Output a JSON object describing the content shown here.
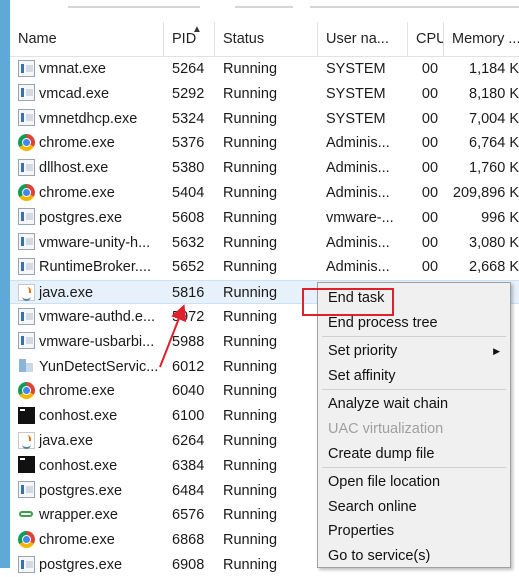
{
  "columns": {
    "name": "Name",
    "pid": "PID",
    "status": "Status",
    "user": "User na...",
    "cpu": "CPU",
    "memory": "Memory ..."
  },
  "processes": [
    {
      "name": "vmnat.exe",
      "icon": "exe",
      "pid": "5264",
      "status": "Running",
      "user": "SYSTEM",
      "cpu": "00",
      "memory": "1,184 K"
    },
    {
      "name": "vmcad.exe",
      "icon": "exe",
      "pid": "5292",
      "status": "Running",
      "user": "SYSTEM",
      "cpu": "00",
      "memory": "8,180 K"
    },
    {
      "name": "vmnetdhcp.exe",
      "icon": "exe",
      "pid": "5324",
      "status": "Running",
      "user": "SYSTEM",
      "cpu": "00",
      "memory": "7,004 K"
    },
    {
      "name": "chrome.exe",
      "icon": "chrome",
      "pid": "5376",
      "status": "Running",
      "user": "Adminis...",
      "cpu": "00",
      "memory": "6,764 K"
    },
    {
      "name": "dllhost.exe",
      "icon": "exe",
      "pid": "5380",
      "status": "Running",
      "user": "Adminis...",
      "cpu": "00",
      "memory": "1,760 K"
    },
    {
      "name": "chrome.exe",
      "icon": "chrome",
      "pid": "5404",
      "status": "Running",
      "user": "Adminis...",
      "cpu": "00",
      "memory": "209,896 K"
    },
    {
      "name": "postgres.exe",
      "icon": "exe",
      "pid": "5608",
      "status": "Running",
      "user": "vmware-...",
      "cpu": "00",
      "memory": "996 K"
    },
    {
      "name": "vmware-unity-h...",
      "icon": "exe",
      "pid": "5632",
      "status": "Running",
      "user": "Adminis...",
      "cpu": "00",
      "memory": "3,080 K"
    },
    {
      "name": "RuntimeBroker....",
      "icon": "exe",
      "pid": "5652",
      "status": "Running",
      "user": "Adminis...",
      "cpu": "00",
      "memory": "2,668 K"
    },
    {
      "name": "java.exe",
      "icon": "java",
      "pid": "5816",
      "status": "Running",
      "user": "",
      "cpu": "",
      "memory": "",
      "selected": true
    },
    {
      "name": "vmware-authd.e...",
      "icon": "exe",
      "pid": "5972",
      "status": "Running",
      "user": "",
      "cpu": "",
      "memory": ""
    },
    {
      "name": "vmware-usbarbi...",
      "icon": "exe",
      "pid": "5988",
      "status": "Running",
      "user": "",
      "cpu": "",
      "memory": ""
    },
    {
      "name": "YunDetectServic...",
      "icon": "yun",
      "pid": "6012",
      "status": "Running",
      "user": "",
      "cpu": "",
      "memory": ""
    },
    {
      "name": "chrome.exe",
      "icon": "chrome",
      "pid": "6040",
      "status": "Running",
      "user": "",
      "cpu": "",
      "memory": ""
    },
    {
      "name": "conhost.exe",
      "icon": "conhost",
      "pid": "6100",
      "status": "Running",
      "user": "",
      "cpu": "",
      "memory": ""
    },
    {
      "name": "java.exe",
      "icon": "java",
      "pid": "6264",
      "status": "Running",
      "user": "",
      "cpu": "",
      "memory": ""
    },
    {
      "name": "conhost.exe",
      "icon": "conhost",
      "pid": "6384",
      "status": "Running",
      "user": "",
      "cpu": "",
      "memory": ""
    },
    {
      "name": "postgres.exe",
      "icon": "exe",
      "pid": "6484",
      "status": "Running",
      "user": "",
      "cpu": "",
      "memory": ""
    },
    {
      "name": "wrapper.exe",
      "icon": "wrapper",
      "pid": "6576",
      "status": "Running",
      "user": "",
      "cpu": "",
      "memory": ""
    },
    {
      "name": "chrome.exe",
      "icon": "chrome",
      "pid": "6868",
      "status": "Running",
      "user": "",
      "cpu": "",
      "memory": ""
    },
    {
      "name": "postgres.exe",
      "icon": "exe",
      "pid": "6908",
      "status": "Running",
      "user": "",
      "cpu": "",
      "memory": ""
    }
  ],
  "context_menu": {
    "items": [
      {
        "label": "End task",
        "highlighted": true
      },
      {
        "label": "End process tree"
      },
      {
        "sep": true
      },
      {
        "label": "Set priority",
        "submenu": true
      },
      {
        "label": "Set affinity"
      },
      {
        "sep": true
      },
      {
        "label": "Analyze wait chain"
      },
      {
        "label": "UAC virtualization",
        "disabled": true
      },
      {
        "label": "Create dump file"
      },
      {
        "sep": true
      },
      {
        "label": "Open file location"
      },
      {
        "label": "Search online"
      },
      {
        "label": "Properties"
      },
      {
        "label": "Go to service(s)"
      }
    ]
  },
  "colors": {
    "highlight_box": "#e0202a",
    "arrow": "#e0202a",
    "left_bar": "#5fa9d8",
    "selected_row": "#e6f1fb"
  }
}
